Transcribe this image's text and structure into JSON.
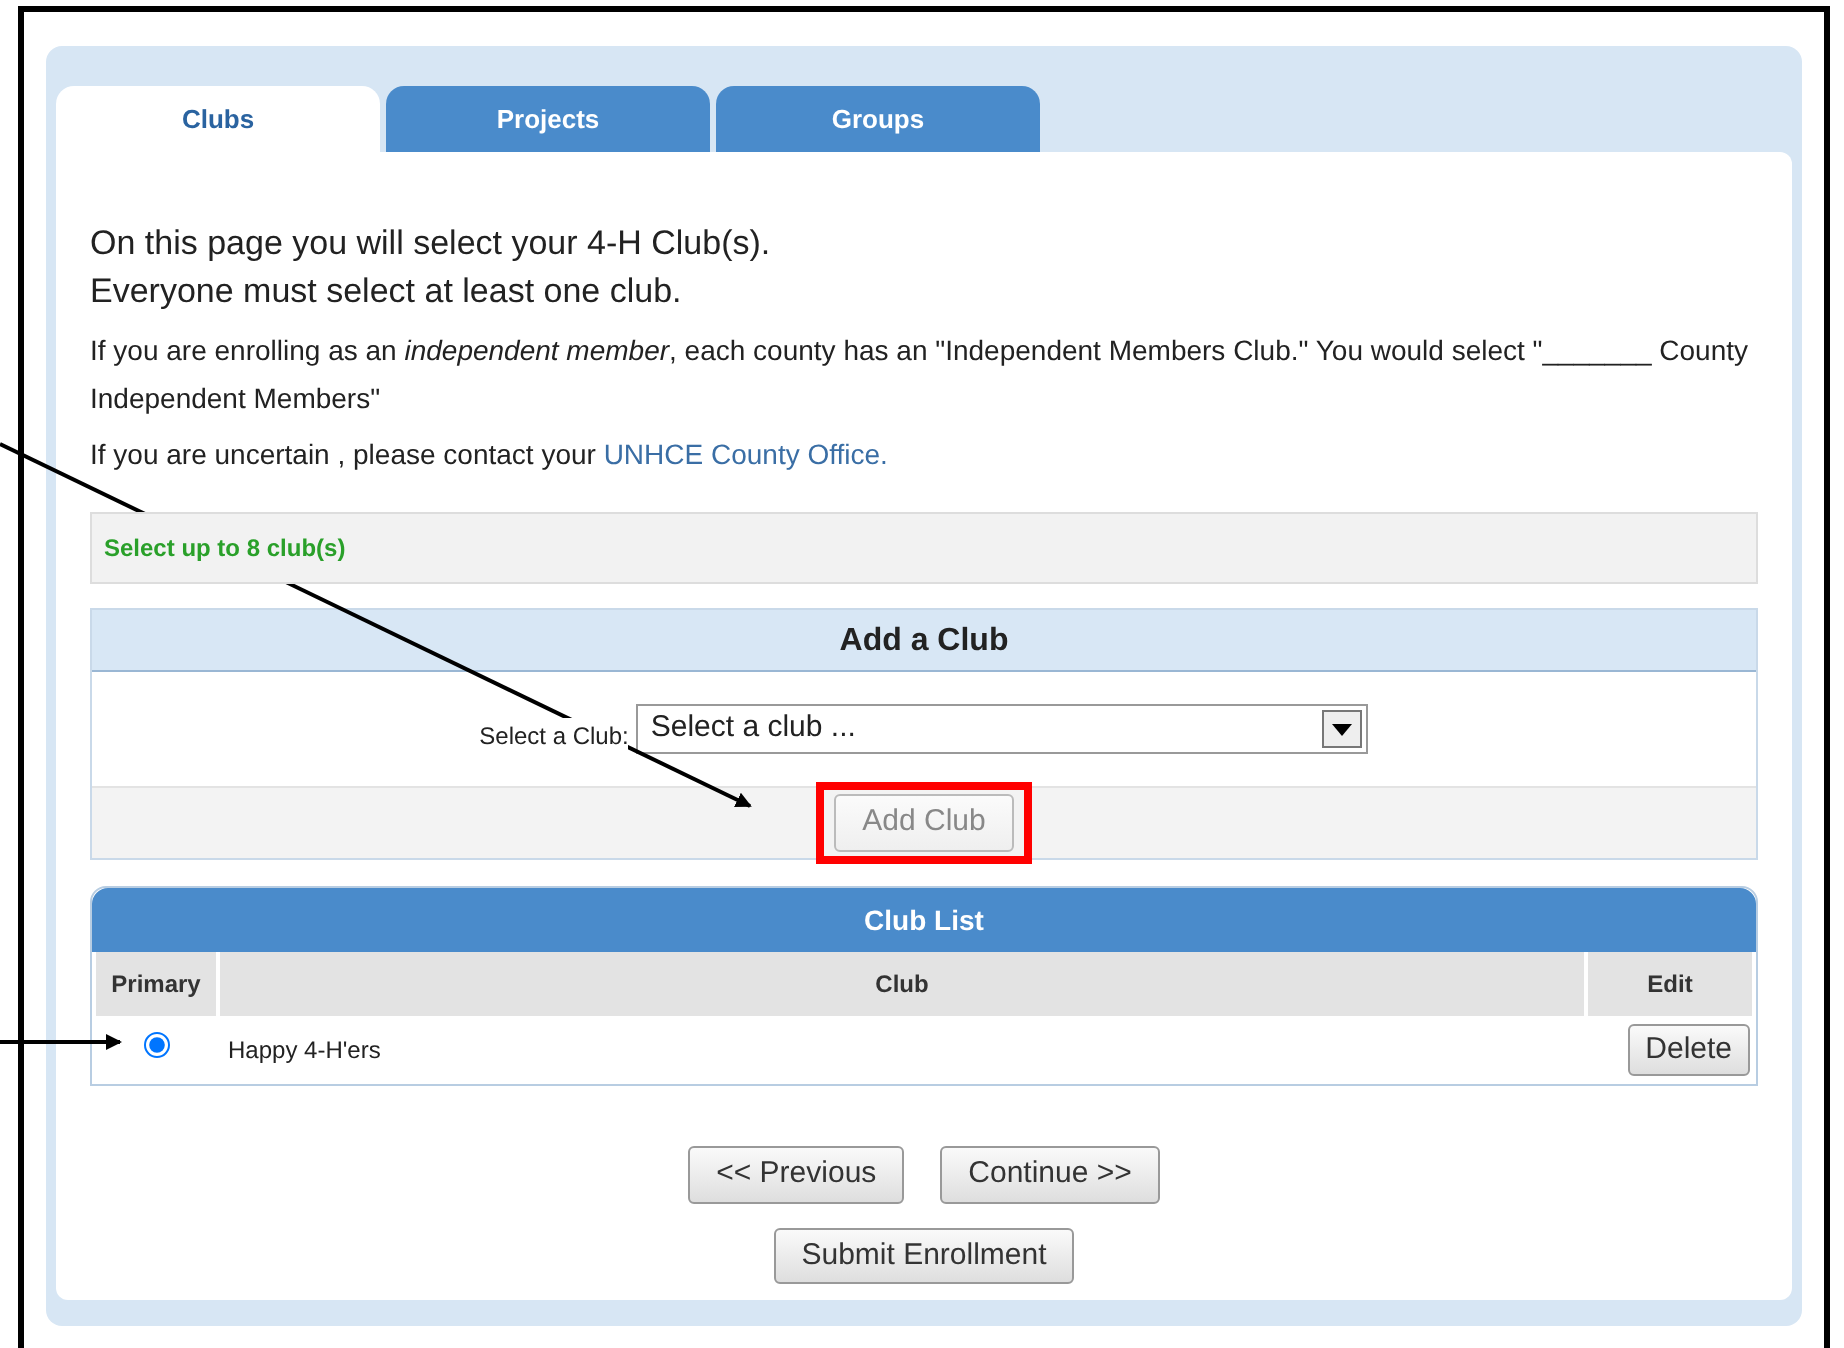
{
  "tabs": [
    {
      "label": "Clubs",
      "selected": true
    },
    {
      "label": "Projects",
      "selected": false
    },
    {
      "label": "Groups",
      "selected": false
    }
  ],
  "heading": [
    "On this page you will select your 4-H Club(s).",
    "Everyone must select at least one club."
  ],
  "intro": "If you are enrolling as an *independent member*, each county has an \"Independent Members Club.\" You would select \"_______ County Independent Members\"",
  "contact": {
    "text": "If you are uncertain , please contact your",
    "link": "UNHCE County Office."
  },
  "limit_note": "Select up to 8 club(s)",
  "add_club": {
    "title": "Add a Club",
    "select_label": "Select a Club:",
    "select_value": "Select a club ...",
    "button": {
      "label": "Add Club",
      "disabled": true,
      "highlighted": true
    }
  },
  "club_list": {
    "title": "Club List",
    "columns": [
      "Primary",
      "Club",
      "Edit"
    ],
    "rows": [
      {
        "primary": true,
        "club": "Happy 4-H'ers",
        "action": "Delete"
      }
    ]
  },
  "nav_buttons": [
    "<< Previous",
    "Continue >>"
  ],
  "submit": "Submit Enrollment"
}
